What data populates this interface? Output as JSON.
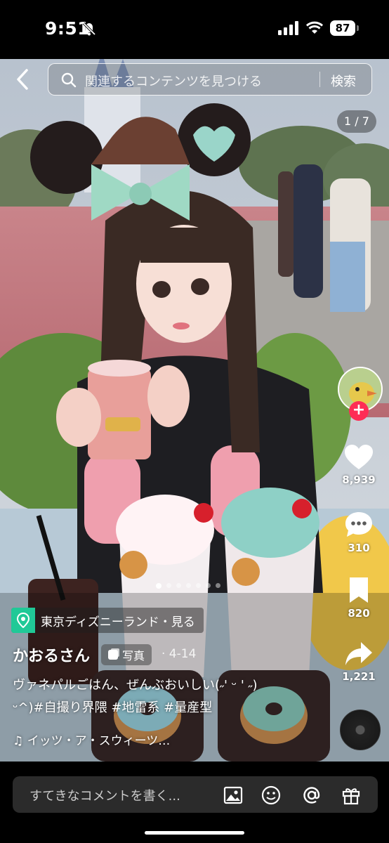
{
  "status_bar": {
    "time": "9:51",
    "battery": "87"
  },
  "search": {
    "placeholder": "関連するコンテンツを見つける",
    "submit_label": "検索"
  },
  "page_counter": "1 / 7",
  "actions": {
    "likes": "8,939",
    "comments": "310",
    "saves": "820",
    "shares": "1,221"
  },
  "carousel": {
    "total": 7,
    "active_index": 0
  },
  "post": {
    "location": "東京ディズニーランド・見る",
    "author": "かおるさん",
    "badge": "写真",
    "date": "· 4-14",
    "caption_line1": "ヴァネパルごはん、ぜんぶおいしい(˶' ᵕ ' ˶)",
    "caption_line2": "ᵕ^)#自撮り界隈 #地雷系 #量産型",
    "music": "♫ イッツ・ア・スウィーツ…"
  },
  "comment_bar": {
    "placeholder": "すてきなコメントを書く..."
  },
  "icons": [
    "back-arrow-icon",
    "search-icon",
    "heart-icon",
    "comment-icon",
    "bookmark-icon",
    "share-icon",
    "location-pin-icon",
    "image-icon",
    "emoji-icon",
    "mention-icon",
    "gift-icon"
  ]
}
